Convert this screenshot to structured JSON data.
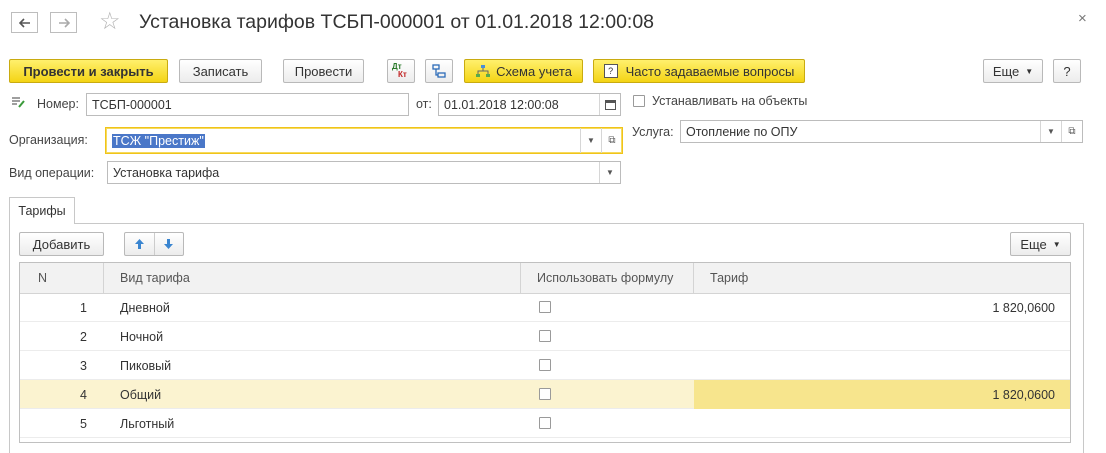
{
  "window": {
    "title": "Установка тарифов ТСБП-000001 от 01.01.2018 12:00:08",
    "back_icon": "arrow-left-icon",
    "forward_icon": "arrow-right-icon",
    "favorite_icon": "star-icon",
    "close_glyph": "×"
  },
  "toolbar": {
    "post_close_label": "Провести и закрыть",
    "write_label": "Записать",
    "post_label": "Провести",
    "scheme_label": "Схема учета",
    "faq_label": "Часто задаваемые вопросы",
    "more_label": "Еще",
    "help_label": "?",
    "dtkt_dt": "Дт",
    "dtkt_kt": "Кт"
  },
  "form": {
    "number_label": "Номер:",
    "number_value": "ТСБП-000001",
    "date_label": "от:",
    "date_value": "01.01.2018 12:00:08",
    "install_on_objects_label": "Устанавливать на объекты",
    "org_label": "Организация:",
    "org_value": "ТСЖ \"Престиж\"",
    "service_label": "Услуга:",
    "service_value": "Отопление по ОПУ",
    "op_type_label": "Вид операции:",
    "op_type_value": "Установка тарифа"
  },
  "tabs": [
    {
      "label": "Тарифы"
    }
  ],
  "table_toolbar": {
    "add_label": "Добавить",
    "more_label": "Еще"
  },
  "table": {
    "columns": [
      "N",
      "Вид тарифа",
      "Использовать формулу",
      "Тариф"
    ],
    "rows": [
      {
        "n": "1",
        "type": "Дневной",
        "use_formula": false,
        "tariff": "1 820,0600"
      },
      {
        "n": "2",
        "type": "Ночной",
        "use_formula": false,
        "tariff": ""
      },
      {
        "n": "3",
        "type": "Пиковый",
        "use_formula": false,
        "tariff": ""
      },
      {
        "n": "4",
        "type": "Общий",
        "use_formula": false,
        "tariff": "1 820,0600"
      },
      {
        "n": "5",
        "type": "Льготный",
        "use_formula": false,
        "tariff": ""
      }
    ],
    "selected_row": 4
  },
  "colors": {
    "accent_yellow": "#f4d415",
    "selected_row": "#fbf3d0",
    "selected_cell": "#f7e58d",
    "text_selection": "#4a77c8"
  }
}
